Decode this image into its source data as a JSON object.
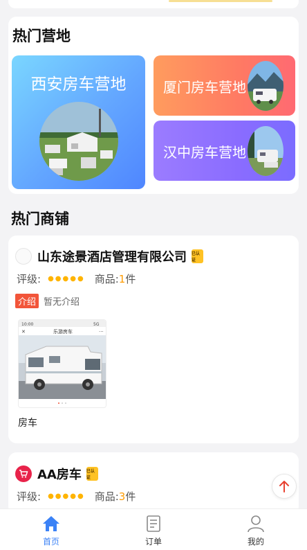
{
  "colors": {
    "accent": "#3b82f6",
    "star": "#ffb400",
    "intro_tag": "#f2553a",
    "cert": "#ffc224"
  },
  "camps": {
    "title": "热门营地",
    "items": [
      {
        "name": "西安房车营地"
      },
      {
        "name": "厦门房车营地"
      },
      {
        "name": "汉中房车营地"
      }
    ]
  },
  "shops": {
    "title": "热门商铺",
    "list": [
      {
        "name": "山东途景酒店管理有限公司",
        "badge": "已认证",
        "rating_label": "评级:",
        "rating_stars": "●●●●●",
        "goods_label": "商品:",
        "goods_count": "1",
        "goods_unit": "件",
        "intro_tag": "介绍",
        "intro_text": "暂无介绍",
        "product": {
          "label": "房车",
          "phone_title": "乐游房车",
          "phone_time": "10:00",
          "phone_status": "5G"
        }
      },
      {
        "name": "AA房车",
        "badge": "已认证",
        "rating_label": "评级:",
        "rating_stars": "●●●●●",
        "goods_label": "商品:",
        "goods_count": "3",
        "goods_unit": "件"
      }
    ]
  },
  "tabbar": {
    "items": [
      {
        "label": "首页",
        "icon": "home-icon",
        "active": true
      },
      {
        "label": "订单",
        "icon": "order-icon",
        "active": false
      },
      {
        "label": "我的",
        "icon": "user-icon",
        "active": false
      }
    ]
  }
}
